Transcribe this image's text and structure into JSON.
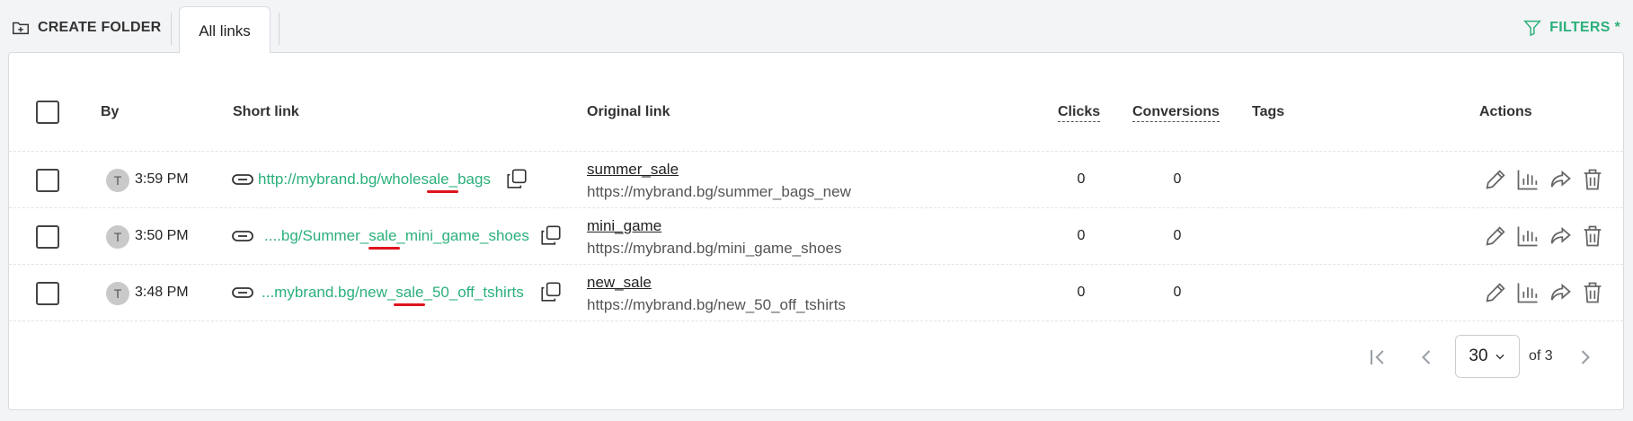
{
  "toolbar": {
    "create_folder_label": "CREATE FOLDER",
    "tab_label": "All links",
    "filters_label": "FILTERS *"
  },
  "table": {
    "headers": {
      "by": "By",
      "short_link": "Short link",
      "original_link": "Original link",
      "clicks": "Clicks",
      "conversions": "Conversions",
      "tags": "Tags",
      "actions": "Actions"
    },
    "rows": [
      {
        "avatar": "T",
        "time": "3:59 PM",
        "short_link": "http://mybrand.bg/wholesale_bags",
        "original_name": "summer_sale",
        "original_url": "https://mybrand.bg/summer_bags_new",
        "clicks": "0",
        "conversions": "0"
      },
      {
        "avatar": "T",
        "time": "3:50 PM",
        "short_link": "....bg/Summer_sale_mini_game_shoes",
        "original_name": "mini_game",
        "original_url": "https://mybrand.bg/mini_game_shoes",
        "clicks": "0",
        "conversions": "0"
      },
      {
        "avatar": "T",
        "time": "3:48 PM",
        "short_link": "...mybrand.bg/new_sale_50_off_tshirts",
        "original_name": "new_sale",
        "original_url": "https://mybrand.bg/new_50_off_tshirts",
        "clicks": "0",
        "conversions": "0"
      }
    ]
  },
  "pagination": {
    "page_size": "30",
    "of_label": "of 3"
  },
  "colors": {
    "accent": "#2bb07a",
    "highlight": "#e0141c"
  },
  "icons": {
    "create_folder": "folder-plus-icon",
    "filters": "filter-icon",
    "link": "link-icon",
    "copy": "copy-icon",
    "edit": "pencil-icon",
    "stats": "bar-chart-icon",
    "share": "share-icon",
    "delete": "trash-icon"
  }
}
